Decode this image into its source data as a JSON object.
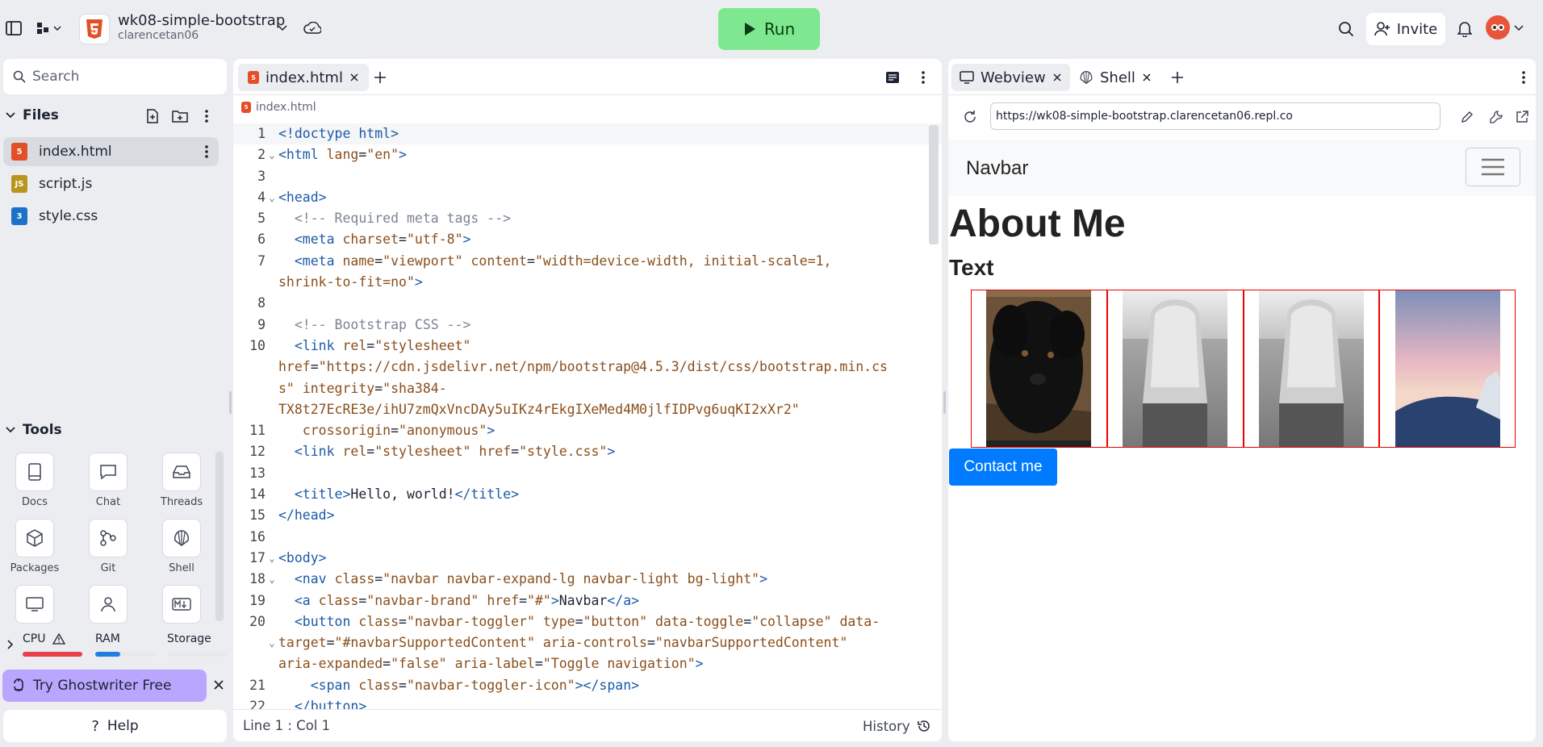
{
  "topbar": {
    "repo_name": "wk08-simple-bootstrap",
    "repo_owner": "clarencetan06",
    "run_label": "Run",
    "invite_label": "Invite"
  },
  "left": {
    "search_placeholder": "Search",
    "files_title": "Files",
    "files": [
      {
        "name": "index.html",
        "type": "html"
      },
      {
        "name": "script.js",
        "type": "js"
      },
      {
        "name": "style.css",
        "type": "css"
      }
    ],
    "tools_title": "Tools",
    "tools": [
      {
        "label": "Docs",
        "icon": "book-icon"
      },
      {
        "label": "Chat",
        "icon": "chat-icon"
      },
      {
        "label": "Threads",
        "icon": "inbox-icon"
      },
      {
        "label": "Packages",
        "icon": "package-icon"
      },
      {
        "label": "Git",
        "icon": "git-icon"
      },
      {
        "label": "Shell",
        "icon": "shell-icon"
      }
    ],
    "resources": {
      "cpu": "CPU",
      "ram": "RAM",
      "storage": "Storage",
      "cpu_level": 1.0,
      "ram_level": 0.42,
      "storage_level": 0.0
    },
    "ghostwriter": "Try Ghostwriter Free",
    "help": "Help"
  },
  "editor": {
    "tab_label": "index.html",
    "breadcrumb": "index.html",
    "status_position": "Line 1 : Col 1",
    "history_label": "History",
    "line_numbers": [
      "1",
      "2",
      "3",
      "4",
      "5",
      "6",
      "7",
      "",
      "8",
      "9",
      "10",
      "",
      "",
      "",
      "11",
      "12",
      "13",
      "14",
      "15",
      "16",
      "17",
      "18",
      "19",
      "20",
      "",
      "",
      "21",
      "22"
    ]
  },
  "webview": {
    "tab_webview": "Webview",
    "tab_shell": "Shell",
    "url": "https://wk08-simple-bootstrap.clarencetan06.repl.co",
    "navbar_brand": "Navbar",
    "heading": "About Me",
    "subheading": "Text",
    "button": "Contact me"
  }
}
